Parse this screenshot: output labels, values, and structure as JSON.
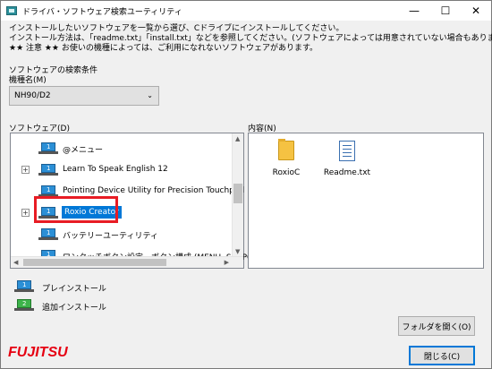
{
  "window": {
    "title": "ドライバ・ソフトウェア検索ユーティリティ",
    "minimize": "—",
    "maximize": "☐",
    "close": "✕"
  },
  "instructions": {
    "line1": "インストールしたいソフトウェアを一覧から選び、Cドライブにインストールしてください。",
    "line2": "インストール方法は、「readme.txt」「install.txt」などを参照してください。(ソフトウェアによっては用意されていない場合もあります)",
    "line3": "★★ 注意 ★★ お使いの機種によっては、ご利用になれないソフトウェアがあります。"
  },
  "search": {
    "section_label": "ソフトウェアの検索条件",
    "model_label": "機種名(M)",
    "model_value": "NH90/D2"
  },
  "software": {
    "label": "ソフトウェア(D)",
    "items": [
      {
        "label": "@メニュー",
        "expandable": false,
        "selected": false,
        "icon": "laptop-blue"
      },
      {
        "label": "Learn To Speak English 12",
        "expandable": true,
        "selected": false,
        "icon": "laptop-blue"
      },
      {
        "label": "Pointing Device Utility for Precision Touchpad",
        "expandable": false,
        "selected": false,
        "icon": "laptop-blue"
      },
      {
        "label": "Roxio Creator",
        "expandable": true,
        "selected": true,
        "icon": "laptop-blue"
      },
      {
        "label": "バッテリーユーティリティ",
        "expandable": false,
        "selected": false,
        "icon": "laptop-blue"
      },
      {
        "label": "ワンタッチボタン設定 - ボタン構成 (MENU, SUPPO",
        "expandable": false,
        "selected": false,
        "icon": "laptop-blue"
      }
    ]
  },
  "contents": {
    "label": "内容(N)",
    "files": [
      {
        "name": "RoxioC",
        "icon": "folder-icon"
      },
      {
        "name": "Readme.txt",
        "icon": "text-file-icon"
      }
    ]
  },
  "legend": {
    "preinstall": "プレインストール",
    "additional": "追加インストール"
  },
  "buttons": {
    "open_folder": "フォルダを開く(O)",
    "close": "閉じる(C)"
  },
  "brand": {
    "logo": "FUJITSU"
  },
  "colors": {
    "selection": "#0078d7",
    "highlight_box": "#e81c24",
    "logo": "#e60012",
    "preinstall_icon": "#2b8fd6",
    "additional_icon": "#3db34a"
  }
}
